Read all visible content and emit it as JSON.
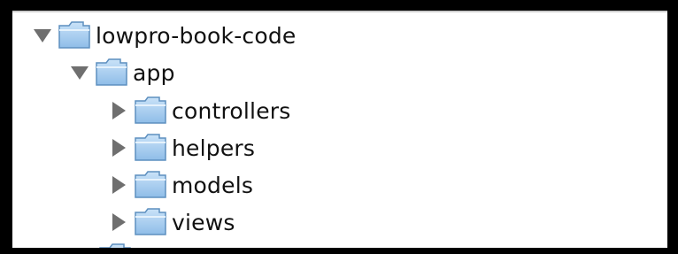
{
  "tree": {
    "root": {
      "label": "lowpro-book-code",
      "expanded": true
    },
    "app": {
      "label": "app",
      "expanded": true
    },
    "children": [
      {
        "label": "controllers",
        "expanded": false
      },
      {
        "label": "helpers",
        "expanded": false
      },
      {
        "label": "models",
        "expanded": false
      },
      {
        "label": "views",
        "expanded": false
      }
    ]
  },
  "icons": {
    "disclosure_expanded": "triangle-down-icon",
    "disclosure_collapsed": "triangle-right-icon",
    "folder": "folder-icon"
  },
  "colors": {
    "folder_fill": "#9ec9ee",
    "folder_outline": "#5d8fbf",
    "triangle": "#6f6f6f"
  }
}
